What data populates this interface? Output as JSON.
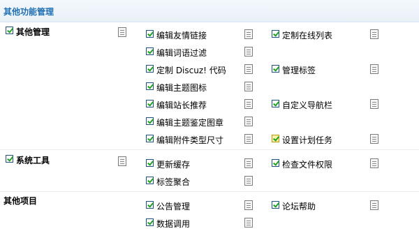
{
  "header": {
    "title": "其他功能管理"
  },
  "sections": {
    "other_management": {
      "label": "其他管理",
      "items": {
        "friend_links": "编辑友情链接",
        "online_list": "定制在线列表",
        "word_filter": "编辑词语过滤",
        "discuz_code": "定制 Discuz! 代码",
        "manage_tags": "管理标签",
        "thread_icons": "编辑主题图标",
        "admin_recommend": "编辑站长推荐",
        "custom_nav": "自定义导航栏",
        "thread_stamps": "编辑主题鉴定图章",
        "attachment_sizes": "编辑附件类型尺寸",
        "scheduled_tasks": "设置计划任务"
      }
    },
    "system_tools": {
      "label": "系统工具",
      "items": {
        "update_cache": "更新缓存",
        "check_permissions": "检查文件权限",
        "tag_aggregate": "标签聚合"
      }
    },
    "other_items": {
      "label": "其他项目",
      "items": {
        "announcements": "公告管理",
        "forum_help": "论坛帮助",
        "data_calls": "数据调用"
      }
    }
  }
}
